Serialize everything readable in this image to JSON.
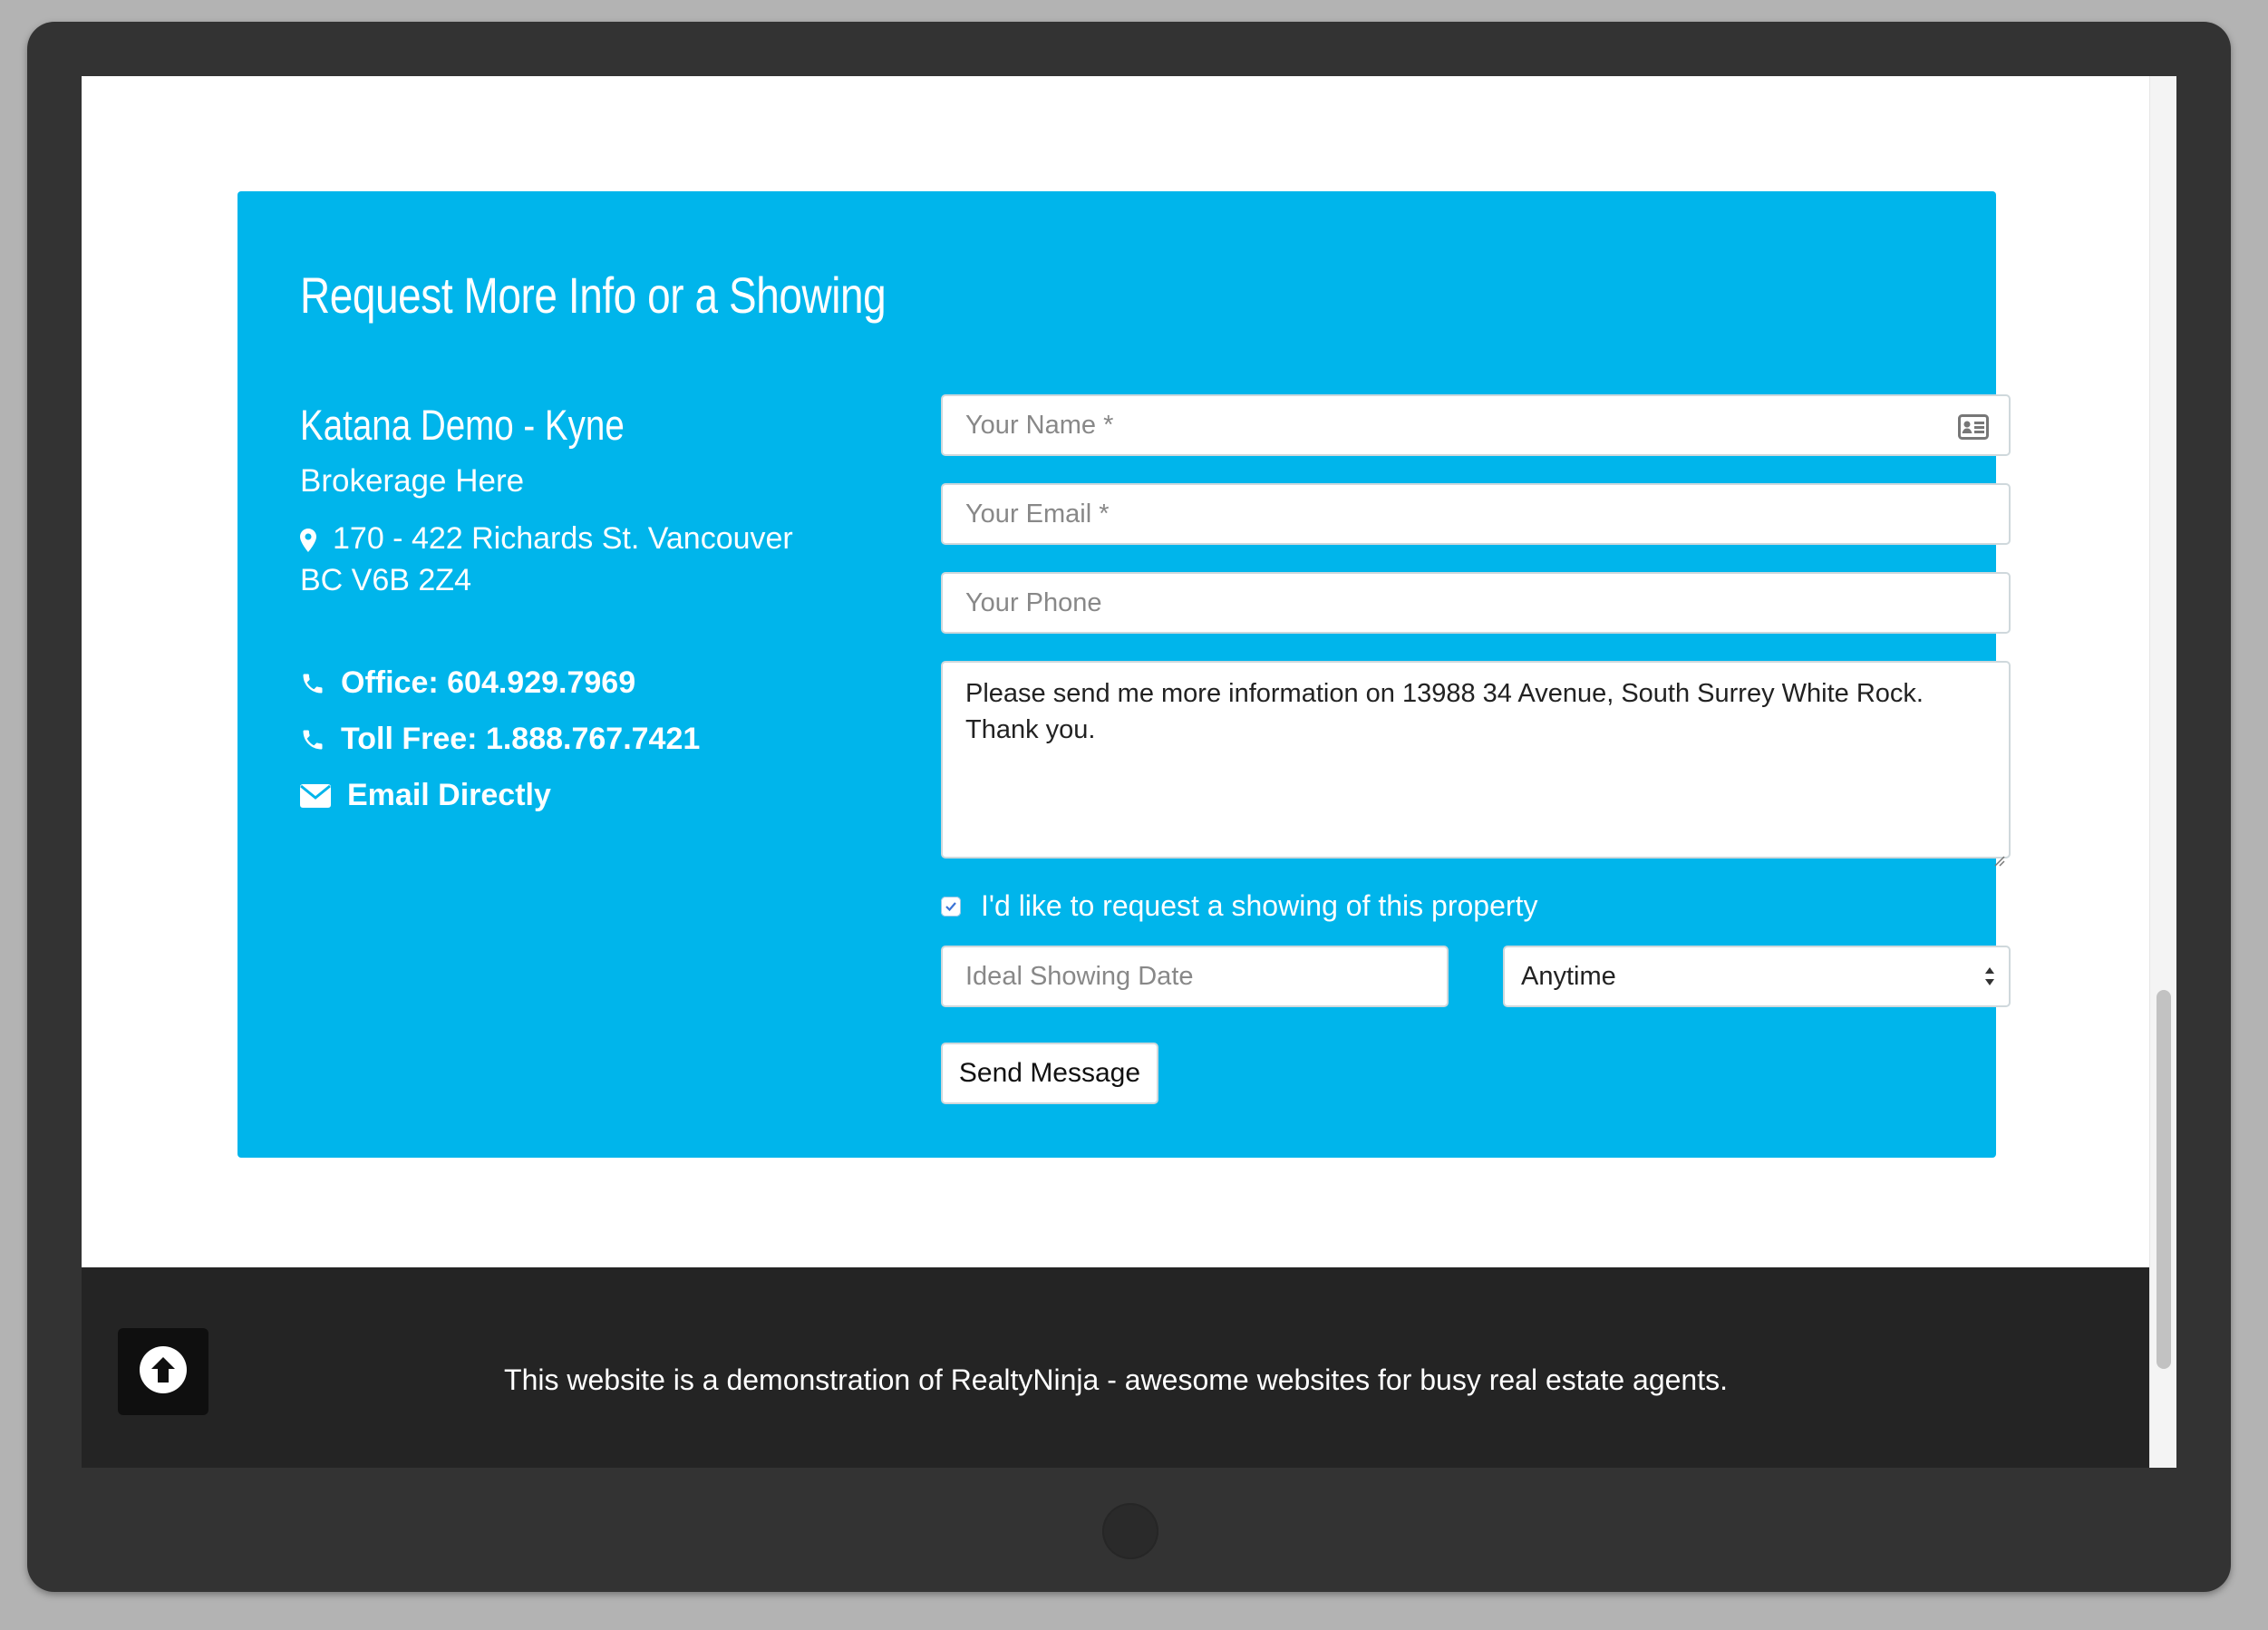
{
  "panel": {
    "title": "Request More Info or a Showing",
    "background_color": "#00b5eb"
  },
  "agent": {
    "name": "Katana Demo - Kyne",
    "brokerage": "Brokerage Here",
    "address_line1": "170 - 422 Richards St. Vancouver",
    "address_line2": "BC V6B 2Z4",
    "address_icon": "map-marker-icon",
    "office": "Office: 604.929.7969",
    "office_icon": "phone-icon",
    "toll_free": "Toll Free: 1.888.767.7421",
    "toll_free_icon": "phone-icon",
    "email_link": "Email Directly",
    "email_icon": "envelope-icon"
  },
  "form": {
    "name_placeholder": "Your Name *",
    "name_field_icon": "contact-card-icon",
    "email_placeholder": "Your Email *",
    "phone_placeholder": "Your Phone",
    "message_value": "Please send me more information on 13988 34 Avenue, South Surrey White Rock. Thank you.",
    "showing_checkbox_label": "I'd like to request a showing of this property",
    "showing_checkbox_checked": true,
    "date_placeholder": "Ideal Showing Date",
    "time_select_value": "Anytime",
    "submit_label": "Send Message"
  },
  "footer": {
    "text": "This website is a demonstration of RealtyNinja - awesome websites for busy real estate agents.",
    "back_to_top_icon": "arrow-up-circle-icon",
    "background_color": "#242424"
  }
}
